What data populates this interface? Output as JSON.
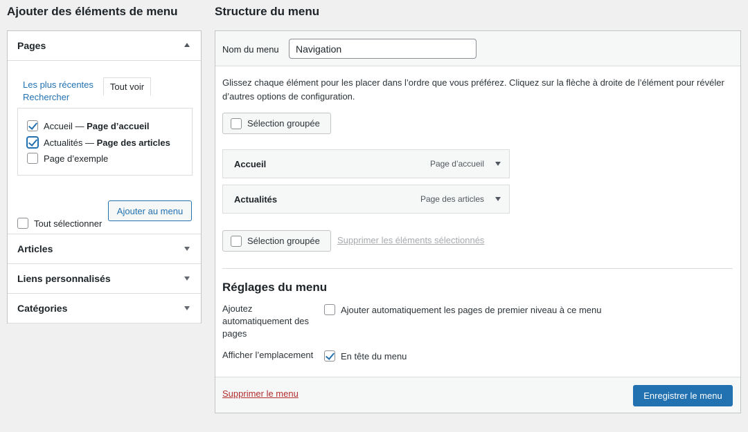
{
  "left": {
    "title": "Ajouter des éléments de menu",
    "pages": {
      "header": "Pages",
      "tabs": {
        "recent": "Les plus récentes",
        "all": "Tout voir",
        "search": "Rechercher"
      },
      "items": [
        {
          "label": "Accueil — ",
          "strong": "Page d’accueil",
          "checked": true
        },
        {
          "label": "Actualités — ",
          "strong": "Page des articles",
          "checked": true
        },
        {
          "label": "Page d’exemple",
          "strong": "",
          "checked": false
        }
      ],
      "select_all": "Tout sélectionner",
      "add_button": "Ajouter au menu"
    },
    "sections": [
      "Articles",
      "Liens personnalisés",
      "Catégories"
    ]
  },
  "right": {
    "title": "Structure du menu",
    "name_label": "Nom du menu",
    "name_value": "Navigation",
    "instructions": "Glissez chaque élément pour les placer dans l’ordre que vous préférez. Cliquez sur la flèche à droite de l’élément pour révéler d’autres options de configuration.",
    "bulk_select": "Sélection groupée",
    "menu_items": [
      {
        "title": "Accueil",
        "type": "Page d’accueil"
      },
      {
        "title": "Actualités",
        "type": "Page des articles"
      }
    ],
    "delete_selected": "Supprimer les éléments sélectionnés",
    "settings": {
      "title": "Réglages du menu",
      "auto_add_label": "Ajoutez automatiquement des pages",
      "auto_add_option": "Ajouter automatiquement les pages de premier niveau à ce menu",
      "auto_add_checked": false,
      "location_label": "Afficher l’emplacement",
      "location_option": "En tête du menu",
      "location_checked": true
    },
    "delete_menu": "Supprimer le menu",
    "save_button": "Enregistrer le menu"
  },
  "colors": {
    "accent": "#2271b1",
    "danger": "#b32d2e",
    "background": "#f0f0f1"
  }
}
